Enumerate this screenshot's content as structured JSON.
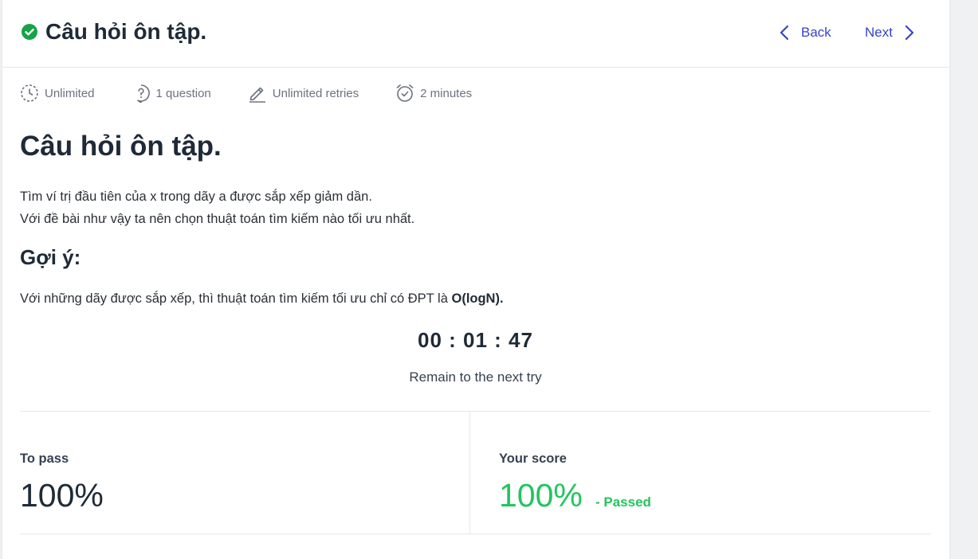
{
  "header": {
    "title": "Câu hỏi ôn tập.",
    "back_label": "Back",
    "next_label": "Next"
  },
  "meta": {
    "duration": "Unlimited",
    "questions": "1 question",
    "retries": "Unlimited retries",
    "time": "2 minutes"
  },
  "content": {
    "heading": "Câu hỏi ôn tập.",
    "line1": "Tìm ví trị đầu tiên của x trong dãy a được sắp xếp giảm dần.",
    "line2": "Với đề bài như vậy ta nên chọn thuật toán tìm kiếm nào tối ưu nhất.",
    "hint_heading": "Gợi ý:",
    "hint_text": "Với những dãy được sắp xếp, thì thuật toán tìm kiếm tối ưu chỉ có ĐPT là ",
    "hint_bold": "O(logN)."
  },
  "timer": {
    "value": "00 : 01 : 47",
    "label": "Remain to the next try"
  },
  "scores": {
    "to_pass_label": "To pass",
    "to_pass_value": "100%",
    "your_score_label": "Your score",
    "your_score_value": "100%",
    "status": "- Passed"
  },
  "colors": {
    "accent": "#3346c7",
    "success": "#22c55e",
    "check": "#16a34a"
  }
}
